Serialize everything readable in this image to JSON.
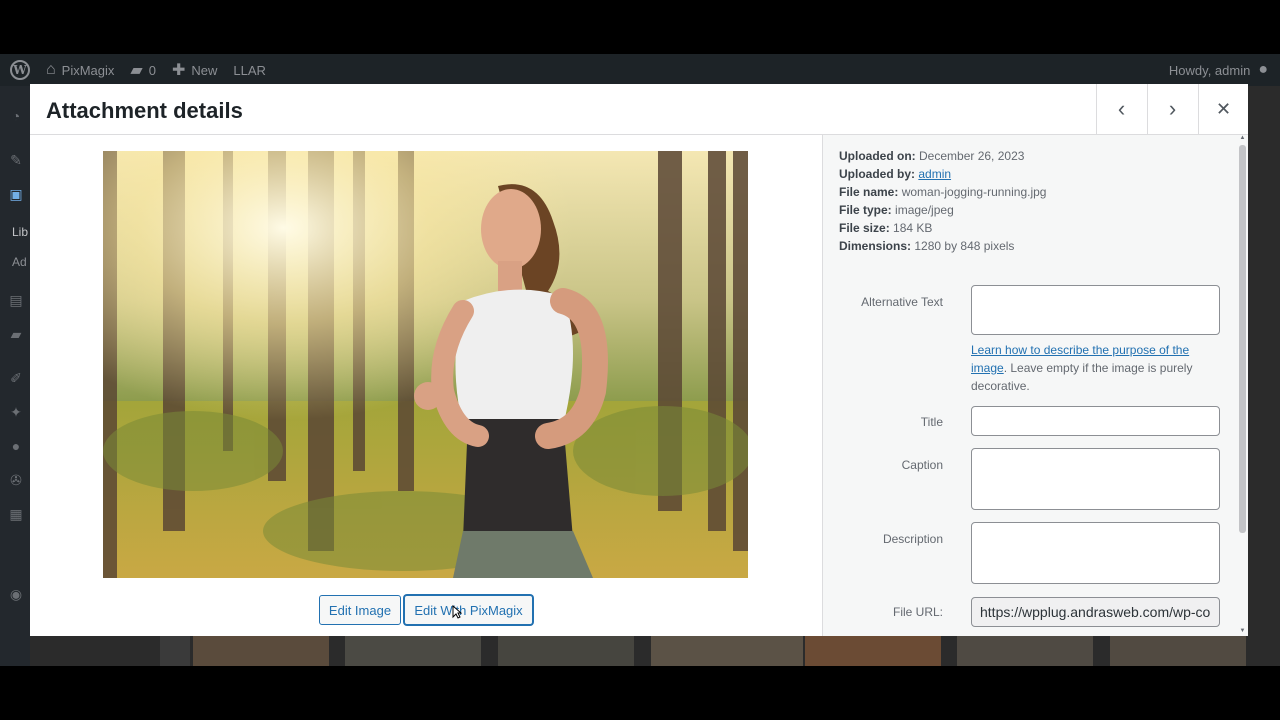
{
  "admin_bar": {
    "site_name": "PixMagix",
    "comments_count": "0",
    "new_label": "New",
    "plugin_label": "LLAR",
    "greeting": "Howdy, admin"
  },
  "sidebar": {
    "library_label": "Lib",
    "add_label": "Ad"
  },
  "modal": {
    "title": "Attachment details",
    "prev_icon": "chevron-left-icon",
    "next_icon": "chevron-right-icon",
    "close_icon": "close-icon"
  },
  "media": {
    "image_alt": "woman-jogging-running.jpg",
    "edit_image_label": "Edit Image",
    "edit_pixmagix_label": "Edit With PixMagix"
  },
  "details": {
    "uploaded_on_label": "Uploaded on:",
    "uploaded_on": "December 26, 2023",
    "uploaded_by_label": "Uploaded by:",
    "uploaded_by": "admin",
    "file_name_label": "File name:",
    "file_name": "woman-jogging-running.jpg",
    "file_type_label": "File type:",
    "file_type": "image/jpeg",
    "file_size_label": "File size:",
    "file_size": "184 KB",
    "dimensions_label": "Dimensions:",
    "dimensions": "1280 by 848 pixels"
  },
  "form": {
    "alt_label": "Alternative Text",
    "alt_value": "",
    "help_link": "Learn how to describe the purpose of the image",
    "help_text": ". Leave empty if the image is purely decorative.",
    "title_label": "Title",
    "title_value": "",
    "caption_label": "Caption",
    "caption_value": "",
    "description_label": "Description",
    "description_value": "",
    "url_label": "File URL:",
    "url_value": "https://wpplug.andrasweb.com/wp-co"
  },
  "colors": {
    "accent": "#2271b1",
    "admin_bar": "#1d2327"
  }
}
